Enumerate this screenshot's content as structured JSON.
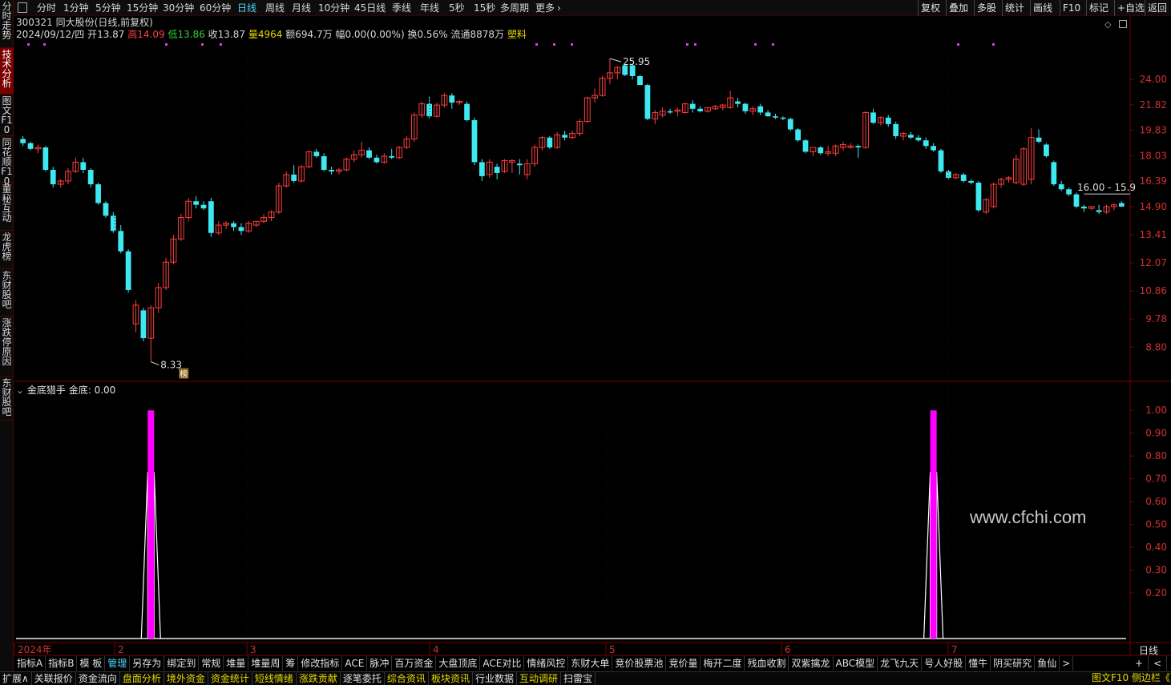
{
  "toolbar": {
    "periods": [
      {
        "label": "分时",
        "active": false
      },
      {
        "label": "1分钟",
        "active": false
      },
      {
        "label": "5分钟",
        "active": false
      },
      {
        "label": "15分钟",
        "active": false
      },
      {
        "label": "30分钟",
        "active": false
      },
      {
        "label": "60分钟",
        "active": false
      },
      {
        "label": "日线",
        "active": true
      },
      {
        "label": "周线",
        "active": false
      },
      {
        "label": "月线",
        "active": false
      },
      {
        "label": "10分钟",
        "active": false
      },
      {
        "label": "45日线",
        "active": false
      },
      {
        "label": "季线",
        "active": false
      },
      {
        "label": "年线",
        "active": false
      },
      {
        "label": "5秒",
        "active": false
      },
      {
        "label": "15秒",
        "active": false
      },
      {
        "label": "多周期",
        "active": false
      },
      {
        "label": "更多",
        "active": false
      }
    ],
    "right_buttons": [
      "复权",
      "叠加",
      "多股",
      "统计",
      "画线",
      "F10",
      "标记",
      "+自选",
      "返回"
    ]
  },
  "sidebar": {
    "tabs": [
      "分时走势",
      "技术分析",
      "图文F10",
      "同花顺F10",
      "董秘互动",
      "龙虎榜",
      "东财股吧",
      "涨跌停原因",
      "东财股吧"
    ]
  },
  "stock": {
    "code": "300321",
    "name": "同大股份",
    "mode": "(日线,前复权)",
    "date": "2024/09/12/四",
    "open_label": "开",
    "open": "13.87",
    "high_label": "高",
    "high": "14.09",
    "low_label": "低",
    "low": "13.86",
    "close_label": "收",
    "close": "13.87",
    "vol_label": "量",
    "vol": "4964",
    "amount": "额694.7万",
    "change": "幅0.00(0.00%)",
    "turnover": "换0.56%",
    "float": "流通8878万",
    "sector": "塑料"
  },
  "chart_annotations": {
    "high_mark": "25.95",
    "low_mark": "8.33",
    "range_label": "16.00 - 15.9",
    "bang_badge": "榜"
  },
  "chart_data": [
    {
      "type": "candlestick",
      "title": "",
      "y_tick_labels": [
        "24.00",
        "21.82",
        "19.83",
        "18.03",
        "16.39",
        "14.90",
        "13.41",
        "12.07",
        "10.86",
        "9.78",
        "8.80"
      ],
      "x_tick_labels": [
        "2024年",
        "2",
        "3",
        "4",
        "5",
        "6",
        "7"
      ],
      "ohlc": [
        [
          19.2,
          19.4,
          18.7,
          18.9
        ],
        [
          18.9,
          19.0,
          18.4,
          18.5
        ],
        [
          18.5,
          18.8,
          18.2,
          18.6
        ],
        [
          18.6,
          18.7,
          17.0,
          17.1
        ],
        [
          17.1,
          17.3,
          16.0,
          16.2
        ],
        [
          16.2,
          16.5,
          16.0,
          16.4
        ],
        [
          16.4,
          17.2,
          16.2,
          17.0
        ],
        [
          17.0,
          17.9,
          16.9,
          17.6
        ],
        [
          17.6,
          17.9,
          16.9,
          17.1
        ],
        [
          17.1,
          17.2,
          16.0,
          16.2
        ],
        [
          16.2,
          16.3,
          15.0,
          15.1
        ],
        [
          15.1,
          15.2,
          14.3,
          14.4
        ],
        [
          14.4,
          14.6,
          13.5,
          13.6
        ],
        [
          13.6,
          13.9,
          12.5,
          12.6
        ],
        [
          12.6,
          12.7,
          10.8,
          10.9
        ],
        [
          9.6,
          10.5,
          9.3,
          10.3
        ],
        [
          10.1,
          10.2,
          9.0,
          9.1
        ],
        [
          9.1,
          10.3,
          8.33,
          10.2
        ],
        [
          10.2,
          11.2,
          10.0,
          11.0
        ],
        [
          11.0,
          12.3,
          10.9,
          12.1
        ],
        [
          12.1,
          13.4,
          12.0,
          13.2
        ],
        [
          13.2,
          14.5,
          13.1,
          14.3
        ],
        [
          14.3,
          15.4,
          14.1,
          15.2
        ],
        [
          15.2,
          15.5,
          14.8,
          15.0
        ],
        [
          15.0,
          15.2,
          14.7,
          14.8
        ],
        [
          15.2,
          15.4,
          13.3,
          13.5
        ],
        [
          13.5,
          14.1,
          13.4,
          13.9
        ],
        [
          13.9,
          14.1,
          13.7,
          14.0
        ],
        [
          14.0,
          14.1,
          13.6,
          13.8
        ],
        [
          13.8,
          14.0,
          13.4,
          13.6
        ],
        [
          13.6,
          14.1,
          13.5,
          14.0
        ],
        [
          13.9,
          14.1,
          13.8,
          14.1
        ],
        [
          14.1,
          14.5,
          14.0,
          14.3
        ],
        [
          14.3,
          14.7,
          14.1,
          14.6
        ],
        [
          14.6,
          16.3,
          14.5,
          16.1
        ],
        [
          16.1,
          17.0,
          16.0,
          16.8
        ],
        [
          16.8,
          17.4,
          16.3,
          16.4
        ],
        [
          16.4,
          17.4,
          16.3,
          17.3
        ],
        [
          17.3,
          18.4,
          17.2,
          18.3
        ],
        [
          18.3,
          18.5,
          17.9,
          18.0
        ],
        [
          18.0,
          18.2,
          17.0,
          17.1
        ],
        [
          17.1,
          17.3,
          16.8,
          17.0
        ],
        [
          17.0,
          17.2,
          16.8,
          17.1
        ],
        [
          17.1,
          17.9,
          17.0,
          17.8
        ],
        [
          17.8,
          18.4,
          17.6,
          18.1
        ],
        [
          18.1,
          19.0,
          17.9,
          18.4
        ],
        [
          18.4,
          18.6,
          17.8,
          17.9
        ],
        [
          17.9,
          18.1,
          17.5,
          17.6
        ],
        [
          17.6,
          18.2,
          17.5,
          18.0
        ],
        [
          18.0,
          18.5,
          17.8,
          17.9
        ],
        [
          17.9,
          18.7,
          17.8,
          18.6
        ],
        [
          18.6,
          19.4,
          18.5,
          19.2
        ],
        [
          19.2,
          21.2,
          19.0,
          21.0
        ],
        [
          21.0,
          22.1,
          20.8,
          21.9
        ],
        [
          21.9,
          22.5,
          20.7,
          20.9
        ],
        [
          20.9,
          22.0,
          20.8,
          21.8
        ],
        [
          21.8,
          22.8,
          21.6,
          22.6
        ],
        [
          22.6,
          22.8,
          21.5,
          22.0
        ],
        [
          22.0,
          22.2,
          21.8,
          22.1
        ],
        [
          21.9,
          22.1,
          20.5,
          20.6
        ],
        [
          20.6,
          20.8,
          17.4,
          17.6
        ],
        [
          17.6,
          17.8,
          16.4,
          16.7
        ],
        [
          16.8,
          17.8,
          16.6,
          17.6
        ],
        [
          17.3,
          17.5,
          16.5,
          16.9
        ],
        [
          17.0,
          17.8,
          16.9,
          17.7
        ],
        [
          17.6,
          17.8,
          16.9,
          17.7
        ],
        [
          17.5,
          17.8,
          16.8,
          17.4
        ],
        [
          16.8,
          17.8,
          16.5,
          17.5
        ],
        [
          17.5,
          18.8,
          17.3,
          18.6
        ],
        [
          18.6,
          19.4,
          18.4,
          19.3
        ],
        [
          19.3,
          19.4,
          18.5,
          18.6
        ],
        [
          18.6,
          19.7,
          18.5,
          19.5
        ],
        [
          19.5,
          19.8,
          19.1,
          19.3
        ],
        [
          19.3,
          19.8,
          19.2,
          19.6
        ],
        [
          19.6,
          20.7,
          19.4,
          20.5
        ],
        [
          20.5,
          22.5,
          20.4,
          22.4
        ],
        [
          22.4,
          23.2,
          22.0,
          22.6
        ],
        [
          22.6,
          24.3,
          22.5,
          24.1
        ],
        [
          24.1,
          25.95,
          23.6,
          24.6
        ],
        [
          24.6,
          25.2,
          24.0,
          25.1
        ],
        [
          25.3,
          25.4,
          24.3,
          24.4
        ],
        [
          25.3,
          25.4,
          24.0,
          24.3
        ],
        [
          24.3,
          24.4,
          23.5,
          23.5
        ],
        [
          23.5,
          23.6,
          20.6,
          20.7
        ],
        [
          20.7,
          21.4,
          20.3,
          21.2
        ],
        [
          21.0,
          21.6,
          20.8,
          21.3
        ],
        [
          21.3,
          21.5,
          21.1,
          21.2
        ],
        [
          21.3,
          21.6,
          20.9,
          21.4
        ],
        [
          21.2,
          22.0,
          21.1,
          21.9
        ],
        [
          21.9,
          22.2,
          21.2,
          21.5
        ],
        [
          21.5,
          21.7,
          21.2,
          21.3
        ],
        [
          21.3,
          21.6,
          21.2,
          21.6
        ],
        [
          21.5,
          21.8,
          21.4,
          21.7
        ],
        [
          21.6,
          21.9,
          21.4,
          21.8
        ],
        [
          21.6,
          23.0,
          21.5,
          22.4
        ],
        [
          22.1,
          22.4,
          21.6,
          21.9
        ],
        [
          21.9,
          22.0,
          21.1,
          21.3
        ],
        [
          21.3,
          21.7,
          21.0,
          21.5
        ],
        [
          21.7,
          21.9,
          21.0,
          21.2
        ],
        [
          21.2,
          21.4,
          20.9,
          20.9
        ],
        [
          20.9,
          21.1,
          20.7,
          20.8
        ],
        [
          20.8,
          20.9,
          20.6,
          20.7
        ],
        [
          20.7,
          20.8,
          19.8,
          19.9
        ],
        [
          19.9,
          20.0,
          19.0,
          19.1
        ],
        [
          19.1,
          19.2,
          18.2,
          18.3
        ],
        [
          18.3,
          18.4,
          18.0,
          18.6
        ],
        [
          18.6,
          18.7,
          18.1,
          18.2
        ],
        [
          18.2,
          18.7,
          18.0,
          18.3
        ],
        [
          18.2,
          18.8,
          18.0,
          18.7
        ],
        [
          18.6,
          19.0,
          18.4,
          18.8
        ],
        [
          18.6,
          18.9,
          18.5,
          18.7
        ],
        [
          18.7,
          18.8,
          17.9,
          18.6
        ],
        [
          18.6,
          21.3,
          18.5,
          21.2
        ],
        [
          21.2,
          21.5,
          20.3,
          20.4
        ],
        [
          20.4,
          20.9,
          20.2,
          20.8
        ],
        [
          20.8,
          21.0,
          20.1,
          20.3
        ],
        [
          20.3,
          20.5,
          19.2,
          19.4
        ],
        [
          19.4,
          19.7,
          19.1,
          19.6
        ],
        [
          19.5,
          19.7,
          19.2,
          19.3
        ],
        [
          19.3,
          19.5,
          19.0,
          19.1
        ],
        [
          19.1,
          19.3,
          18.5,
          18.7
        ],
        [
          18.7,
          18.9,
          18.3,
          18.4
        ],
        [
          18.4,
          18.5,
          16.9,
          17.0
        ],
        [
          17.0,
          17.1,
          16.5,
          16.6
        ],
        [
          16.6,
          16.9,
          16.5,
          16.8
        ],
        [
          16.8,
          16.9,
          16.3,
          16.4
        ],
        [
          16.4,
          16.5,
          16.2,
          16.3
        ],
        [
          16.3,
          16.4,
          14.6,
          14.7
        ],
        [
          14.6,
          15.4,
          14.5,
          15.3
        ],
        [
          14.9,
          16.3,
          14.8,
          16.2
        ],
        [
          16.2,
          16.6,
          16.0,
          16.5
        ],
        [
          16.5,
          16.7,
          16.3,
          16.6
        ],
        [
          16.3,
          18.1,
          16.2,
          17.8
        ],
        [
          16.2,
          18.6,
          16.1,
          18.5
        ],
        [
          16.5,
          20.0,
          16.2,
          19.3
        ],
        [
          19.3,
          19.9,
          18.9,
          19.0
        ],
        [
          18.8,
          18.9,
          17.9,
          18.0
        ],
        [
          17.6,
          17.7,
          16.1,
          16.2
        ],
        [
          16.2,
          16.4,
          15.8,
          15.9
        ],
        [
          15.9,
          16.0,
          15.5,
          15.6
        ],
        [
          15.6,
          15.7,
          14.8,
          14.9
        ],
        [
          14.9,
          15.0,
          14.6,
          14.8
        ],
        [
          14.8,
          14.9,
          14.7,
          14.9
        ],
        [
          14.7,
          15.0,
          14.5,
          14.6
        ],
        [
          14.6,
          15.0,
          14.5,
          14.9
        ],
        [
          14.9,
          15.1,
          14.7,
          15.0
        ],
        [
          15.1,
          15.2,
          14.9,
          14.9
        ]
      ],
      "ylim_log": [
        8.0,
        27.4
      ]
    },
    {
      "type": "line",
      "title": "金底猎手",
      "series": [
        {
          "name": "金底",
          "values_at_signal": [
            1.0,
            1.0
          ]
        }
      ],
      "current_value_label": "金底: 0.00",
      "y_tick_labels": [
        "1.00",
        "0.90",
        "0.80",
        "0.70",
        "0.60",
        "0.50",
        "0.40",
        "0.30",
        "0.20"
      ],
      "ylim": [
        0,
        1.05
      ],
      "signal_indices": [
        17,
        121
      ]
    }
  ],
  "watermark": "www.cfchi.com",
  "x_axis_right_label": "日线",
  "indicator_tabs": [
    {
      "label": "指标A",
      "sel": false
    },
    {
      "label": "指标B",
      "sel": false
    },
    {
      "label": "模 板",
      "sel": false
    },
    {
      "label": "管理",
      "sel": true
    },
    {
      "label": "另存为",
      "sel": false
    },
    {
      "label": "绑定到",
      "sel": false
    },
    {
      "label": "常规",
      "sel": false
    },
    {
      "label": "堆量",
      "sel": false
    },
    {
      "label": "堆量周",
      "sel": false
    },
    {
      "label": "筹",
      "sel": false
    },
    {
      "label": "修改指标",
      "sel": false
    },
    {
      "label": "ACE",
      "sel": false
    },
    {
      "label": "脉冲",
      "sel": false
    },
    {
      "label": "百万资金",
      "sel": false
    },
    {
      "label": "大盘顶底",
      "sel": false
    },
    {
      "label": "ACE对比",
      "sel": false
    },
    {
      "label": "情绪风控",
      "sel": false
    },
    {
      "label": "东财大单",
      "sel": false
    },
    {
      "label": "竞价股票池",
      "sel": false
    },
    {
      "label": "竞价量",
      "sel": false
    },
    {
      "label": "梅开二度",
      "sel": false
    },
    {
      "label": "残血收割",
      "sel": false
    },
    {
      "label": "双紫擒龙",
      "sel": false
    },
    {
      "label": "ABC模型",
      "sel": false
    },
    {
      "label": "龙飞九天",
      "sel": false
    },
    {
      "label": "号人好股",
      "sel": false
    },
    {
      "label": "懂牛",
      "sel": false
    },
    {
      "label": "阴买研究",
      "sel": false
    },
    {
      "label": "鱼仙",
      "sel": false
    },
    {
      "label": ">",
      "sel": false
    }
  ],
  "indicator_tabs_right": [
    "+",
    "<",
    ">"
  ],
  "bottom_tabs": [
    {
      "label": "扩展∧",
      "yellow": false
    },
    {
      "label": "关联报价",
      "yellow": false
    },
    {
      "label": "资金流向",
      "yellow": false
    },
    {
      "label": "盘面分析",
      "yellow": true
    },
    {
      "label": "境外资金",
      "yellow": true
    },
    {
      "label": "资金统计",
      "yellow": true
    },
    {
      "label": "短线情绪",
      "yellow": true
    },
    {
      "label": "涨跌贡献",
      "yellow": true
    },
    {
      "label": "逐笔委托",
      "yellow": false
    },
    {
      "label": "综合资讯",
      "yellow": true
    },
    {
      "label": "板块资讯",
      "yellow": true
    },
    {
      "label": "行业数据",
      "yellow": false
    },
    {
      "label": "互动调研",
      "yellow": true
    },
    {
      "label": "扫雷宝",
      "yellow": false
    }
  ],
  "bottom_right": "图文F10 侧边栏《"
}
